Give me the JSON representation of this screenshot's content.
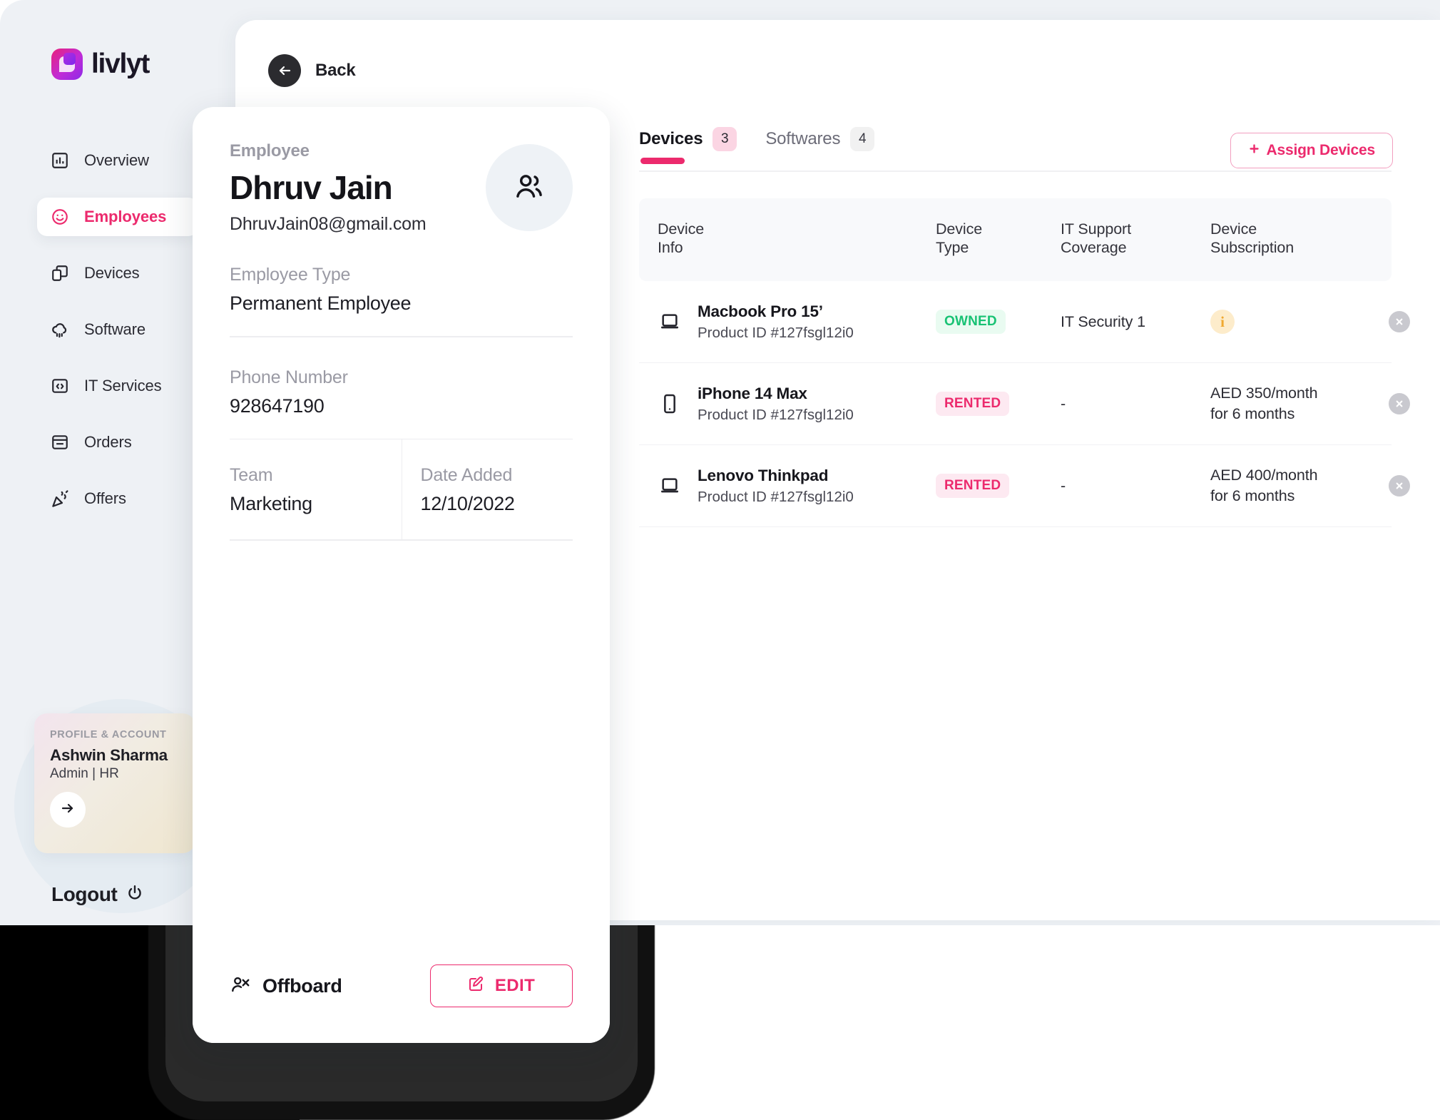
{
  "brand": {
    "name": "livlyt",
    "accent": "#ec2a6d"
  },
  "sidebar": {
    "items": [
      {
        "label": "Overview",
        "icon": "chart-icon",
        "active": false
      },
      {
        "label": "Employees",
        "icon": "smiley-icon",
        "active": true
      },
      {
        "label": "Devices",
        "icon": "devices-icon",
        "active": false
      },
      {
        "label": "Software",
        "icon": "cloud-icon",
        "active": false
      },
      {
        "label": "IT Services",
        "icon": "code-icon",
        "active": false
      },
      {
        "label": "Orders",
        "icon": "orders-icon",
        "active": false
      },
      {
        "label": "Offers",
        "icon": "party-icon",
        "active": false
      }
    ],
    "profile": {
      "kicker": "PROFILE & ACCOUNT",
      "name": "Ashwin Sharma",
      "role": "Admin | HR",
      "arrow_icon": "arrow-right-icon"
    },
    "logout": {
      "label": "Logout",
      "icon": "power-icon"
    }
  },
  "main": {
    "back": {
      "label": "Back",
      "icon": "arrow-left-icon"
    },
    "tabs": [
      {
        "label": "Devices",
        "badge": "3",
        "active": true
      },
      {
        "label": "Softwares",
        "badge": "4",
        "active": false
      }
    ],
    "assign_button": {
      "label": "Assign Devices",
      "icon": "plus-icon"
    },
    "table": {
      "headers": [
        {
          "line1": "Device",
          "line2": "Info"
        },
        {
          "line1": "Device",
          "line2": "Type"
        },
        {
          "line1": "IT Support",
          "line2": "Coverage"
        },
        {
          "line1": "Device",
          "line2": "Subscription"
        },
        {
          "line1": "",
          "line2": ""
        }
      ],
      "rows": [
        {
          "icon": "laptop-icon",
          "name": "Macbook Pro 15’",
          "product_id": "Product ID #127fsgl12i0",
          "type": "OWNED",
          "type_state": "owned",
          "coverage": "IT Security 1",
          "subscription": "",
          "subscription_info_icon": "info-icon",
          "has_info": true,
          "close_icon": "close-icon"
        },
        {
          "icon": "phone-icon",
          "name": "iPhone 14 Max",
          "product_id": "Product ID #127fsgl12i0",
          "type": "RENTED",
          "type_state": "rented",
          "coverage": "-",
          "subscription": "AED 350/month\nfor 6 months",
          "has_info": false,
          "close_icon": "close-icon"
        },
        {
          "icon": "laptop-icon",
          "name": "Lenovo Thinkpad",
          "product_id": "Product ID #127fsgl12i0",
          "type": "RENTED",
          "type_state": "rented",
          "coverage": "-",
          "subscription": "AED 400/month\nfor 6 months",
          "has_info": false,
          "close_icon": "close-icon"
        }
      ]
    }
  },
  "employee_card": {
    "kicker": "Employee",
    "name": "Dhruv Jain",
    "email": "DhruvJain08@gmail.com",
    "avatar_icon": "users-icon",
    "employee_type": {
      "label": "Employee Type",
      "value": "Permanent Employee"
    },
    "phone": {
      "label": "Phone Number",
      "value": "928647190"
    },
    "team": {
      "label": "Team",
      "value": "Marketing"
    },
    "date_added": {
      "label": "Date Added",
      "value": "12/10/2022"
    },
    "footer": {
      "offboard": {
        "label": "Offboard",
        "icon": "offboard-icon"
      },
      "edit": {
        "label": "EDIT",
        "icon": "edit-icon"
      }
    }
  }
}
